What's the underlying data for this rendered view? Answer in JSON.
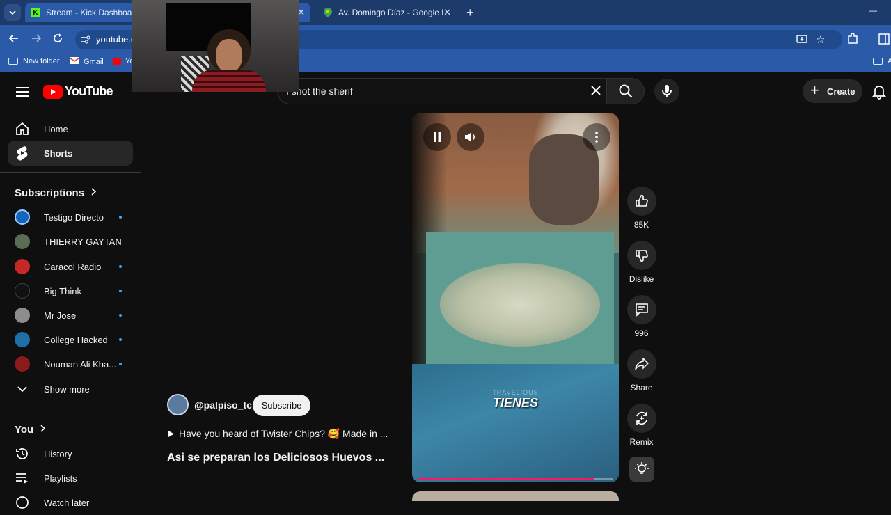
{
  "browser": {
    "tabs": [
      {
        "title": "Stream - Kick Dashboard",
        "icon": "kick-icon"
      },
      {
        "title": "Av. Domingo Díaz - Google Ma",
        "icon": "maps-pin-icon"
      }
    ],
    "url": "youtube.c",
    "bookmarks": [
      {
        "label": "New folder"
      },
      {
        "label": "Gmail"
      },
      {
        "label": "Yo"
      }
    ],
    "bookmarks_right_label": "A",
    "minimize_glyph": "—"
  },
  "youtube": {
    "logo_text": "YouTube",
    "search_value": "I shot the sherif",
    "create_label": "Create",
    "nav": [
      {
        "label": "Home",
        "icon": "home-icon"
      },
      {
        "label": "Shorts",
        "icon": "shorts-icon"
      }
    ],
    "subscriptions_heading": "Subscriptions",
    "subscriptions": [
      {
        "name": "Testigo Directo",
        "color": "#1565c0",
        "new": true
      },
      {
        "name": "THIERRY GAYTAN",
        "color": "#5b6e55",
        "new": false
      },
      {
        "name": "Caracol Radio",
        "color": "#c62828",
        "new": true
      },
      {
        "name": "Big Think",
        "color": "#111111",
        "new": true
      },
      {
        "name": "Mr Jose",
        "color": "#8d8d8d",
        "new": true
      },
      {
        "name": "College Hacked",
        "color": "#1e6fa8",
        "new": true
      },
      {
        "name": "Nouman Ali Kha...",
        "color": "#8b1a1a",
        "new": true
      }
    ],
    "show_more": "Show more",
    "you_heading": "You",
    "you_items": [
      {
        "label": "History",
        "icon": "history-icon"
      },
      {
        "label": "Playlists",
        "icon": "playlists-icon"
      },
      {
        "label": "Watch later",
        "icon": "watch-later-icon"
      }
    ],
    "short": {
      "channel": "@palpiso_tc",
      "subscribe": "Subscribe",
      "description": "Have you heard of Twister Chips? 🥰 Made in ...",
      "title": "Asi se preparan los Deliciosos Huevos ...",
      "caption": "TIENES",
      "watermark": "TRAVELIOUS",
      "progress": 0.9
    },
    "actions": [
      {
        "label": "85K",
        "icon": "thumbs-up-icon"
      },
      {
        "label": "Dislike",
        "icon": "thumbs-down-icon"
      },
      {
        "label": "996",
        "icon": "comment-icon"
      },
      {
        "label": "Share",
        "icon": "share-icon"
      },
      {
        "label": "Remix",
        "icon": "remix-icon"
      }
    ]
  }
}
